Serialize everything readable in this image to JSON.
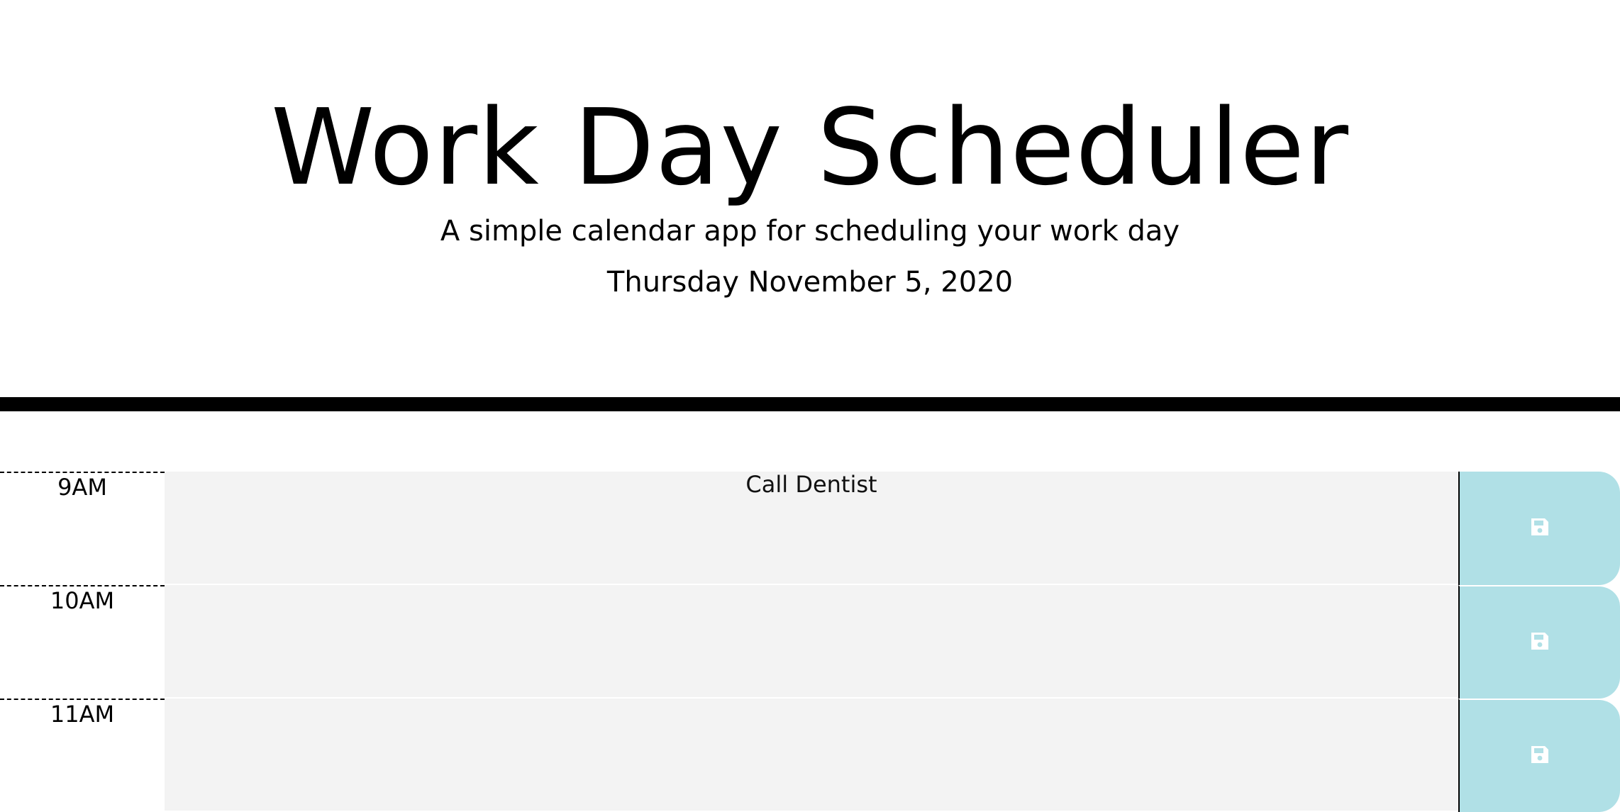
{
  "header": {
    "title": "Work Day Scheduler",
    "subtitle": "A simple calendar app for scheduling your work day",
    "current_day": "Thursday November 5, 2020"
  },
  "colors": {
    "past": "#f3f3f3",
    "save_button": "#b0e0e6",
    "save_icon": "#ffffff"
  },
  "timeblocks": [
    {
      "hour": "9AM",
      "description": "Call Dentist",
      "save_icon": "floppy-disk-icon"
    },
    {
      "hour": "10AM",
      "description": "",
      "save_icon": "floppy-disk-icon"
    },
    {
      "hour": "11AM",
      "description": "",
      "save_icon": "floppy-disk-icon"
    }
  ]
}
